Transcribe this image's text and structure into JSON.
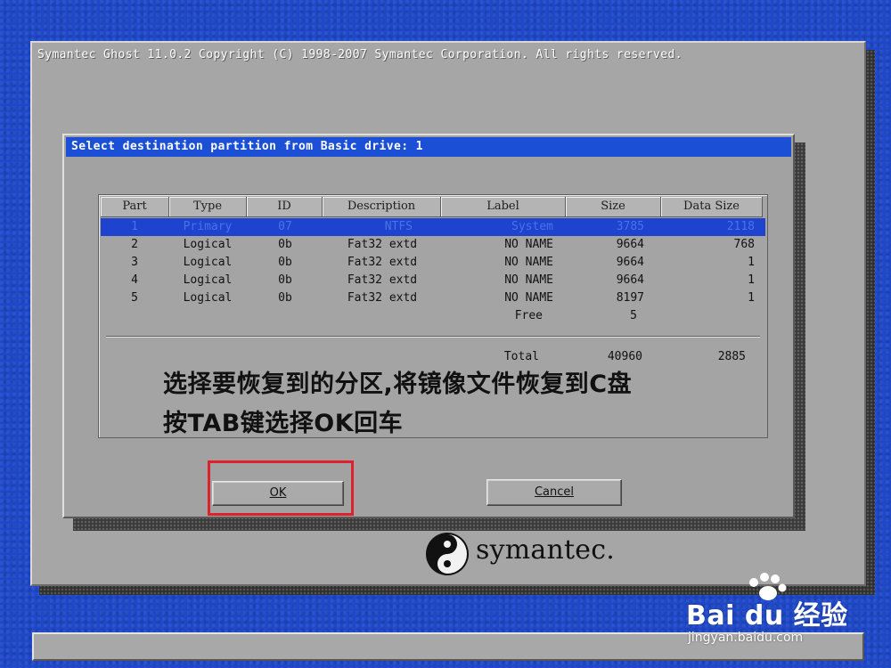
{
  "window": {
    "title": "Symantec Ghost 11.0.2   Copyright (C) 1998-2007 Symantec Corporation. All rights reserved."
  },
  "dialog": {
    "title": "Select destination partition from Basic drive: 1",
    "columns": [
      "Part",
      "Type",
      "ID",
      "Description",
      "Label",
      "Size",
      "Data Size"
    ],
    "rows": [
      {
        "part": "1",
        "type": "Primary",
        "id": "07",
        "description": "NTFS",
        "label": "System",
        "size": "3785",
        "data_size": "2118",
        "selected": true
      },
      {
        "part": "2",
        "type": "Logical",
        "id": "0b",
        "description": "Fat32 extd",
        "label": "NO NAME",
        "size": "9664",
        "data_size": "768"
      },
      {
        "part": "3",
        "type": "Logical",
        "id": "0b",
        "description": "Fat32 extd",
        "label": "NO NAME",
        "size": "9664",
        "data_size": "1"
      },
      {
        "part": "4",
        "type": "Logical",
        "id": "0b",
        "description": "Fat32 extd",
        "label": "NO NAME",
        "size": "9664",
        "data_size": "1"
      },
      {
        "part": "5",
        "type": "Logical",
        "id": "0b",
        "description": "Fat32 extd",
        "label": "NO NAME",
        "size": "8197",
        "data_size": "1"
      },
      {
        "part": "",
        "type": "",
        "id": "",
        "description": "",
        "label": "Free",
        "size": "5",
        "data_size": ""
      }
    ],
    "total": {
      "label": "Total",
      "size": "40960",
      "data_size": "2885"
    },
    "annotation_line1": "选择要恢复到的分区,将镜像文件恢复到C盘",
    "annotation_line2": "按TAB键选择OK回车",
    "ok_label": "OK",
    "cancel_label": "Cancel"
  },
  "logo": {
    "text": "symantec.",
    "icon": "symantec-logo-icon"
  },
  "watermark": {
    "brand": "Bai du 经验",
    "url": "jingyan.baidu.com"
  },
  "colors": {
    "desktop": "#1f48c8",
    "window": "#a6a6a6",
    "title_bar": "#1a4fd6",
    "selection": "#1d43cf",
    "highlight_box": "#e0202a"
  }
}
